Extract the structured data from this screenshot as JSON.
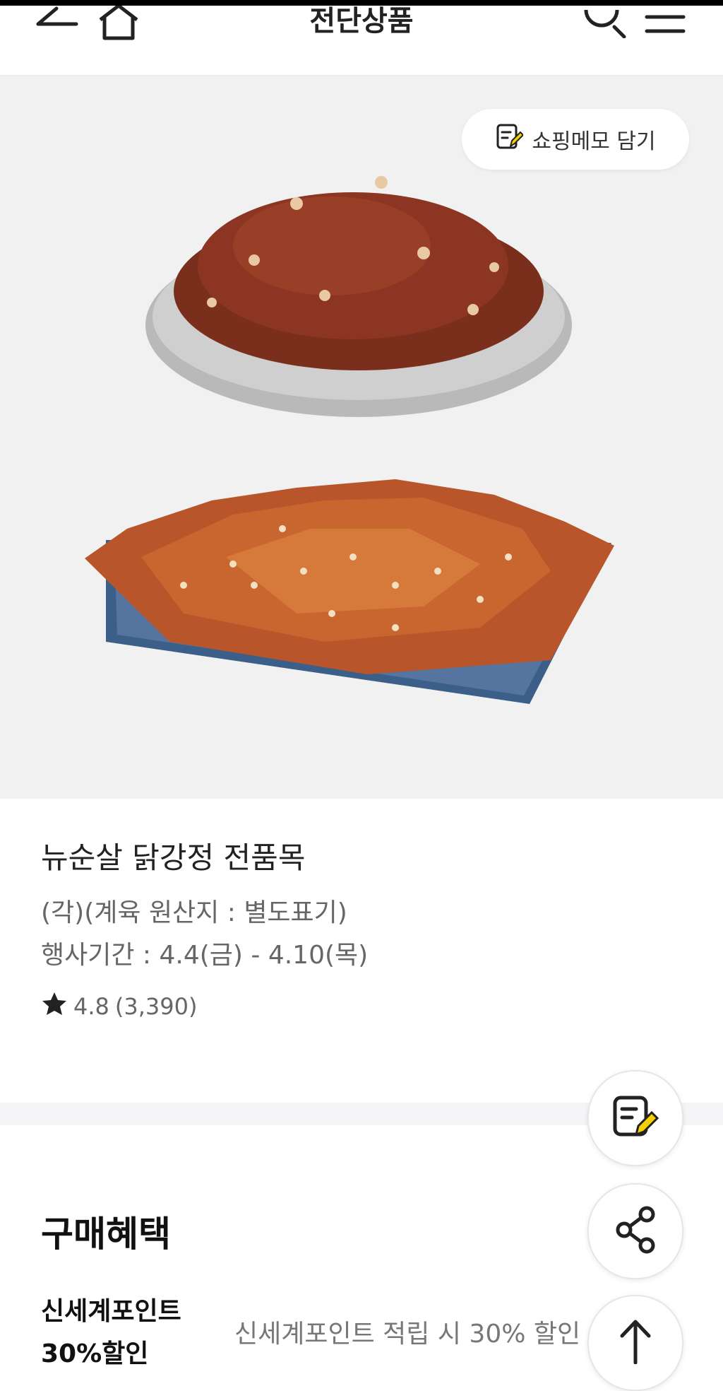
{
  "header": {
    "title": "전단상품",
    "back_icon": "back-arrow-icon",
    "home_icon": "home-icon",
    "search_icon": "search-icon",
    "menu_icon": "hamburger-menu-icon"
  },
  "hero": {
    "memo_label": "쇼핑메모 담기",
    "memo_icon": "memo-pencil-icon"
  },
  "product": {
    "title": "뉴순살 닭강정 전품목",
    "subtitle": "(각)(계육 원산지 : 별도표기)",
    "period": "행사기간 : 4.4(금) - 4.10(목)",
    "rating": "4.8",
    "review_count": "(3,390)",
    "rating_icon": "star-icon"
  },
  "benefits": {
    "heading": "구매혜택",
    "items": [
      {
        "label_line1": "신세계포인트",
        "label_line2": "30%할인",
        "description": "신세계포인트 적립 시 30% 할인"
      }
    ]
  },
  "fabs": {
    "memo_icon": "memo-pencil-icon",
    "share_icon": "share-icon",
    "top_icon": "arrow-up-icon"
  },
  "colors": {
    "accent_yellow": "#f5d000",
    "hero_bg": "#f1f1f1",
    "text_primary": "#222222",
    "text_secondary": "#666666"
  }
}
